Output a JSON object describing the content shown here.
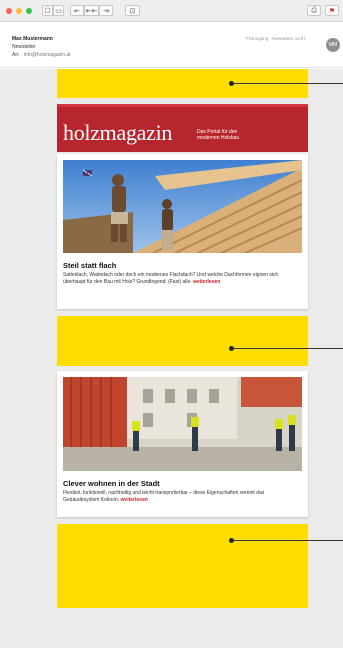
{
  "mail": {
    "sender": "Max Mustermann",
    "subject": "Newsletter",
    "to_label": "An:",
    "to_value": "Info@holzmagazin.at",
    "meta": "FSEingang - Newsletter   11:07",
    "avatar": "MM"
  },
  "toolbar": {
    "buttons": [
      "☐",
      "▭",
      "⇤",
      "⇤⇤",
      "⇥",
      "⊡"
    ],
    "print_icon": "⎙",
    "flag_icon": "⚑"
  },
  "newsletter": {
    "logo": "holzmagazin",
    "tagline_1": "Das Portal für den",
    "tagline_2": "modernen Holzbau",
    "articles": [
      {
        "title": "Steil statt flach",
        "body": "Satteldach, Walmdach oder doch ein modernes Flachdach? Und welche Dachformen eignen sich überhaupt für den Bau mit Holz? Grundlegend: (Fast) alle.",
        "more": "weiterlesen"
      },
      {
        "title": "Clever wohnen in der Stadt",
        "body": "Flexibel, funktionell, nachhaltig und leicht transportierbar – diese Eigenschaften vereint das Gebäudesystem Kokoon.",
        "more": "weiterlesen"
      }
    ]
  },
  "colors": {
    "ad_yellow": "#ffdd00",
    "brand_red": "#b8262d",
    "link_red": "#c8202a",
    "canvas_grey": "#ebebeb"
  }
}
